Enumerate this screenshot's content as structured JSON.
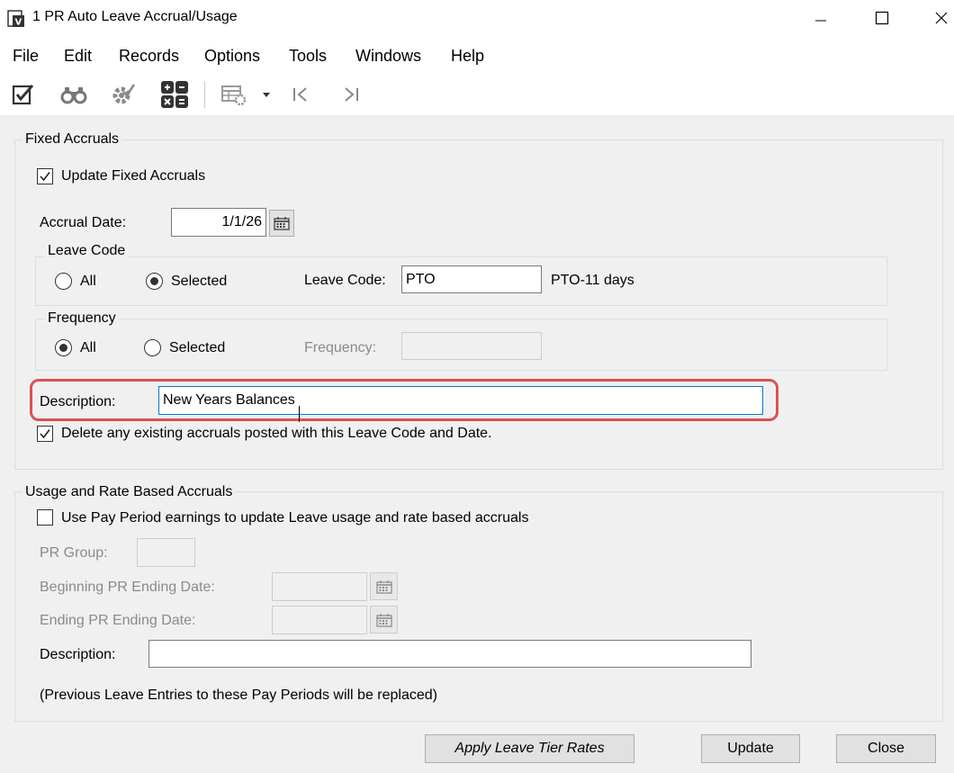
{
  "window": {
    "title": "1 PR Auto Leave Accrual/Usage"
  },
  "menu": [
    "File",
    "Edit",
    "Records",
    "Options",
    "Tools",
    "Windows",
    "Help"
  ],
  "toolbar": {
    "icons": [
      "edit-check-icon",
      "binoculars-icon",
      "gear-icon",
      "calculator-icon",
      "grid-settings-icon",
      "dropdown-arrow-icon",
      "first-record-icon",
      "last-record-icon"
    ]
  },
  "fixed_accruals": {
    "legend": "Fixed Accruals",
    "update_checkbox_label": "Update Fixed Accruals",
    "update_checked": true,
    "accrual_date_label": "Accrual Date:",
    "accrual_date_value": "1/1/26",
    "leave_code_group": {
      "legend": "Leave Code",
      "radio_all": "All",
      "radio_selected": "Selected",
      "selected_option": "Selected",
      "field_label": "Leave Code:",
      "field_value": "PTO",
      "field_description": "PTO-11 days"
    },
    "frequency_group": {
      "legend": "Frequency",
      "radio_all": "All",
      "radio_selected": "Selected",
      "selected_option": "All",
      "field_label": "Frequency:",
      "field_value": ""
    },
    "description_label": "Description:",
    "description_value": "New Years Balances",
    "delete_checkbox_label": "Delete any existing accruals posted with this Leave Code and Date.",
    "delete_checked": true
  },
  "usage_accruals": {
    "legend": "Usage and Rate Based Accruals",
    "use_pay_period_label": "Use Pay Period earnings to update Leave usage and rate based accruals",
    "use_pay_period_checked": false,
    "pr_group_label": "PR Group:",
    "pr_group_value": "",
    "beginning_date_label": "Beginning PR Ending Date:",
    "beginning_date_value": "",
    "ending_date_label": "Ending PR Ending Date:",
    "ending_date_value": "",
    "description_label": "Description:",
    "description_value": "",
    "note": "(Previous Leave Entries to these Pay Periods will be replaced)"
  },
  "buttons": {
    "apply_tier_rates": "Apply Leave Tier Rates",
    "update": "Update",
    "close": "Close"
  },
  "colors": {
    "highlight": "#d9534f",
    "focus_border": "#0078d7",
    "panel_bg": "#f0f0f0"
  }
}
